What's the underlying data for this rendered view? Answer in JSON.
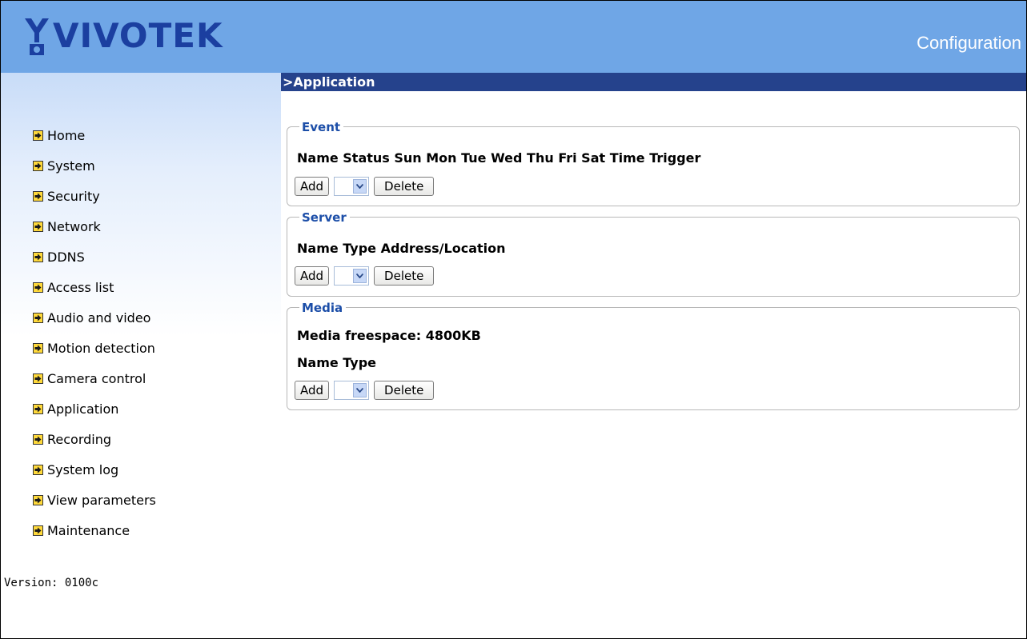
{
  "header": {
    "logo_text": "VIVOTEK",
    "title": "Configuration"
  },
  "sidebar": {
    "items": [
      {
        "label": "Home"
      },
      {
        "label": "System"
      },
      {
        "label": "Security"
      },
      {
        "label": "Network"
      },
      {
        "label": "DDNS"
      },
      {
        "label": "Access list"
      },
      {
        "label": "Audio and video"
      },
      {
        "label": "Motion detection"
      },
      {
        "label": "Camera control"
      },
      {
        "label": "Application"
      },
      {
        "label": "Recording"
      },
      {
        "label": "System log"
      },
      {
        "label": "View parameters"
      },
      {
        "label": "Maintenance"
      }
    ],
    "version": "Version: 0100c"
  },
  "main": {
    "section_title": ">Application",
    "event": {
      "legend": "Event",
      "columns": "Name Status Sun Mon Tue Wed Thu Fri Sat Time Trigger",
      "add_label": "Add",
      "delete_label": "Delete"
    },
    "server": {
      "legend": "Server",
      "columns": "Name Type Address/Location",
      "add_label": "Add",
      "delete_label": "Delete"
    },
    "media": {
      "legend": "Media",
      "freespace": "Media freespace: 4800KB",
      "columns": "Name Type",
      "add_label": "Add",
      "delete_label": "Delete"
    }
  },
  "colors": {
    "header_bg": "#6fa6e6",
    "section_bar": "#25428c",
    "legend_text": "#1c4ea8",
    "nav_arrow": "#ffd93a"
  }
}
